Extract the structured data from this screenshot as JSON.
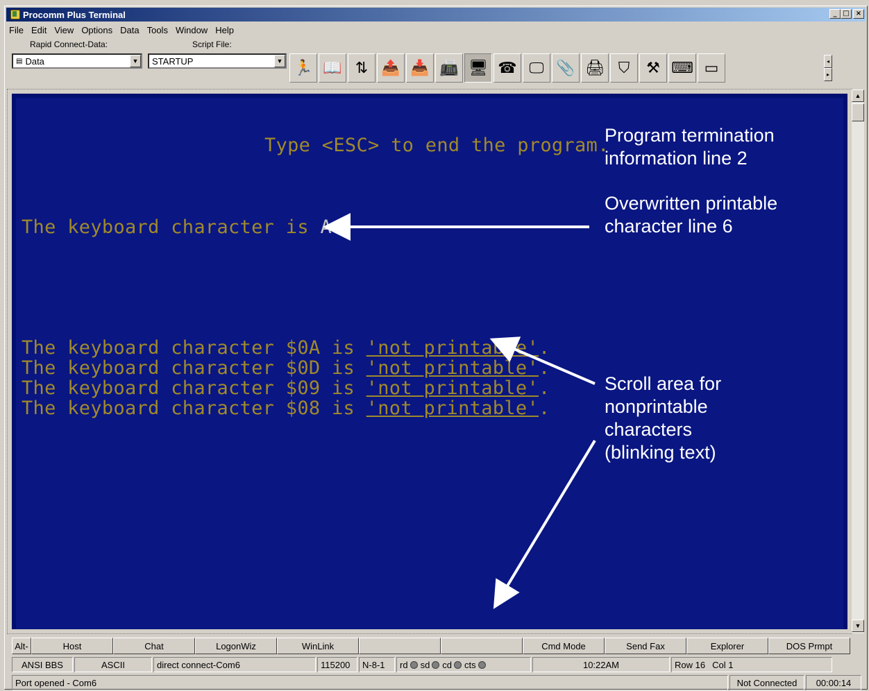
{
  "window": {
    "title": "Procomm Plus Terminal",
    "buttons": [
      "_",
      "□",
      "×"
    ]
  },
  "menu": [
    "File",
    "Edit",
    "View",
    "Options",
    "Data",
    "Tools",
    "Window",
    "Help"
  ],
  "toolbar": {
    "rapid_connect_label": "Rapid Connect-Data:",
    "rapid_connect_value": "Data",
    "script_label": "Script File:",
    "script_value": "STARTUP",
    "tools": [
      {
        "name": "run-script-icon",
        "glyph": "🏃"
      },
      {
        "name": "phonebook-icon",
        "glyph": "📖"
      },
      {
        "name": "mode-icon",
        "glyph": "⇅"
      },
      {
        "name": "send-file-icon",
        "glyph": "📤"
      },
      {
        "name": "receive-file-icon",
        "glyph": "📥"
      },
      {
        "name": "fax-icon",
        "glyph": "📠"
      },
      {
        "name": "terminal-icon",
        "glyph": "🖥"
      },
      {
        "name": "hangup-phone-icon",
        "glyph": "☎"
      },
      {
        "name": "monitor-icon",
        "glyph": "🖵"
      },
      {
        "name": "clipboard-icon",
        "glyph": "📎"
      },
      {
        "name": "printer-icon",
        "glyph": "🖨"
      },
      {
        "name": "capture-icon",
        "glyph": "⛉"
      },
      {
        "name": "tools-icon",
        "glyph": "⚒"
      },
      {
        "name": "user-tools-icon",
        "glyph": "⌨"
      },
      {
        "name": "keyboard-icon",
        "glyph": "▭"
      }
    ]
  },
  "terminal": {
    "line_top": "Type <ESC> to end the program.",
    "line_char_prefix": "The keyboard character is ",
    "line_char_value": "A",
    "line_char_suffix": ".",
    "np_rows": [
      {
        "prefix": "The keyboard character $0A is ",
        "tag": "'not printable'",
        "suffix": "."
      },
      {
        "prefix": "The keyboard character $0D is ",
        "tag": "'not printable'",
        "suffix": "."
      },
      {
        "prefix": "The keyboard character $09 is ",
        "tag": "'not printable'",
        "suffix": "."
      },
      {
        "prefix": "The keyboard character $08 is ",
        "tag": "'not printable'",
        "suffix": "."
      }
    ],
    "annotations": {
      "termination": [
        "Program termination",
        "information line 2"
      ],
      "overwritten": [
        "Overwritten printable",
        "character line 6"
      ],
      "scroll": [
        "Scroll area for",
        "nonprintable",
        "characters",
        "(blinking text)"
      ]
    },
    "colors": {
      "background": "#0a1682",
      "text": "#a08a2a",
      "annotation": "#ffffff"
    }
  },
  "button_bar": [
    "Alt-",
    "Host",
    "Chat",
    "LogonWiz",
    "WinLink",
    "",
    "",
    "Cmd Mode",
    "Send Fax",
    "Explorer",
    "DOS Prmpt"
  ],
  "status": {
    "emulation": "ANSI BBS",
    "transfer": "ASCII",
    "connection": "direct connect-Com6",
    "baud": "115200",
    "parity": "N-8-1",
    "leds": [
      "rd",
      "sd",
      "cd",
      "cts"
    ],
    "time": "10:22AM",
    "row": "Row 16",
    "col": "Col 1"
  },
  "messages": {
    "port": "Port opened - Com6",
    "connection_state": "Not Connected",
    "elapsed": "00:00:14"
  }
}
